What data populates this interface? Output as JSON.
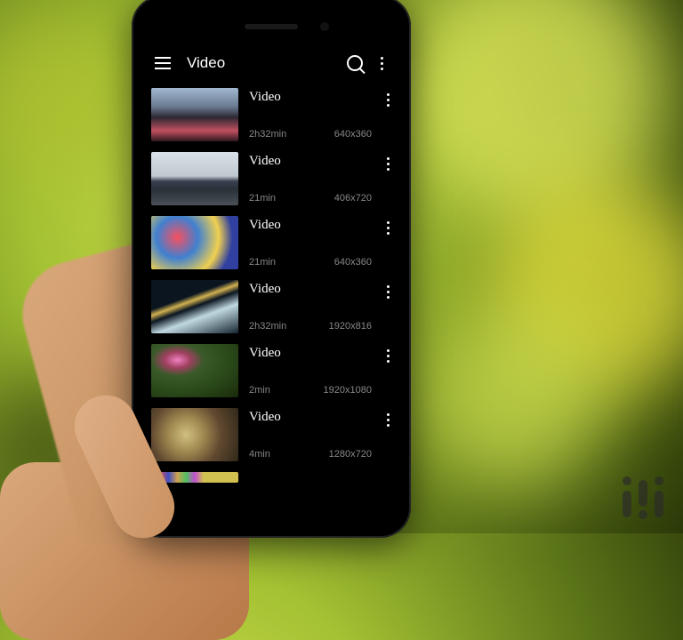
{
  "header": {
    "title": "Video"
  },
  "videos": [
    {
      "title": "Video",
      "duration": "2h32min",
      "resolution": "640x360"
    },
    {
      "title": "Video",
      "duration": "21min",
      "resolution": "406x720"
    },
    {
      "title": "Video",
      "duration": "21min",
      "resolution": "640x360"
    },
    {
      "title": "Video",
      "duration": "2h32min",
      "resolution": "1920x816"
    },
    {
      "title": "Video",
      "duration": "2min",
      "resolution": "1920x1080"
    },
    {
      "title": "Video",
      "duration": "4min",
      "resolution": "1280x720"
    }
  ]
}
